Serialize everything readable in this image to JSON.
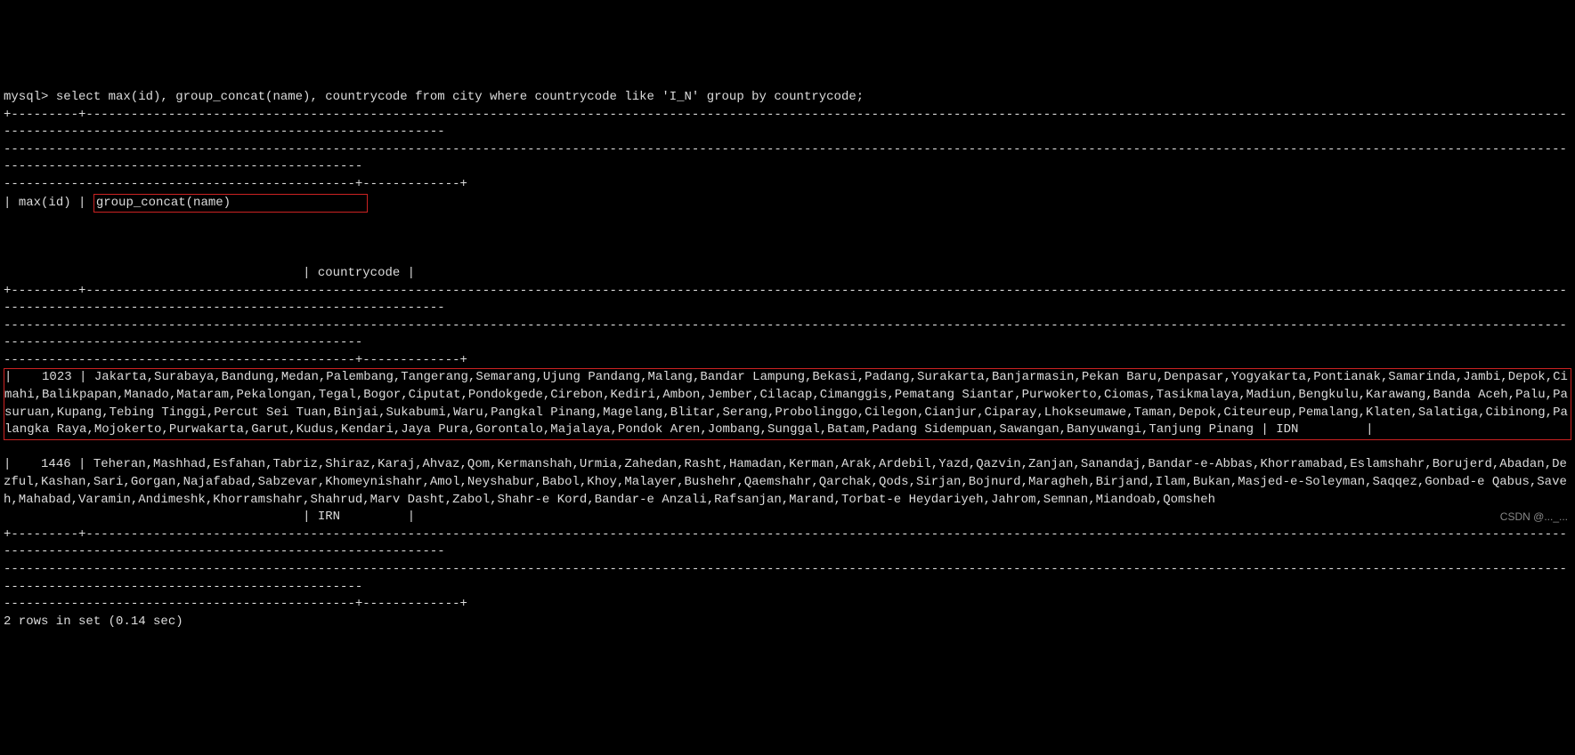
{
  "prompt": "mysql> ",
  "query": "select max(id), group_concat(name), countrycode from city where countrycode like 'I_N' group by countrycode;",
  "sep_long": "-----------------------------------------------------------------------------------------------------------------------------------------------------------------------------------------------------------------------------------------------------------------",
  "sep_short": "-----------------------------------------------",
  "header": {
    "maxid": "max(id)",
    "gconcat": "group_concat(name)",
    "cc_line": "                                        | countrycode |"
  },
  "rows": [
    {
      "id": "1023",
      "names": "Jakarta,Surabaya,Bandung,Medan,Palembang,Tangerang,Semarang,Ujung Pandang,Malang,Bandar Lampung,Bekasi,Padang,Surakarta,Banjarmasin,Pekan Baru,Denpasar,Yogyakarta,Pontianak,Samarinda,Jambi,Depok,Cimahi,Balikpapan,Manado,Mataram,Pekalongan,Tegal,Bogor,Ciputat,Pondokgede,Cirebon,Kediri,Ambon,Jember,Cilacap,Cimanggis,Pematang Siantar,Purwokerto,Ciomas,Tasikmalaya,Madiun,Bengkulu,Karawang,Banda Aceh,Palu,Pasuruan,Kupang,Tebing Tinggi,Percut Sei Tuan,Binjai,Sukabumi,Waru,Pangkal Pinang,Magelang,Blitar,Serang,Probolinggo,Cilegon,Cianjur,Ciparay,Lhokseumawe,Taman,Depok,Citeureup,Pemalang,Klaten,Salatiga,Cibinong,Palangka Raya,Mojokerto,Purwakarta,Garut,Kudus,Kendari,Jaya Pura,Gorontalo,Majalaya,Pondok Aren,Jombang,Sunggal,Batam,Padang Sidempuan,Sawangan,Banyuwangi,Tanjung Pinang",
      "cc": "IDN"
    },
    {
      "id": "1446",
      "names": "Teheran,Mashhad,Esfahan,Tabriz,Shiraz,Karaj,Ahvaz,Qom,Kermanshah,Urmia,Zahedan,Rasht,Hamadan,Kerman,Arak,Ardebil,Yazd,Qazvin,Zanjan,Sanandaj,Bandar-e-Abbas,Khorramabad,Eslamshahr,Borujerd,Abadan,Dezful,Kashan,Sari,Gorgan,Najafabad,Sabzevar,Khomeynishahr,Amol,Neyshabur,Babol,Khoy,Malayer,Bushehr,Qaemshahr,Qarchak,Qods,Sirjan,Bojnurd,Maragheh,Birjand,Ilam,Bukan,Masjed-e-Soleyman,Saqqez,Gonbad-e Qabus,Saveh,Mahabad,Varamin,Andimeshk,Khorramshahr,Shahrud,Marv Dasht,Zabol,Shahr-e Kord,Bandar-e Anzali,Rafsanjan,Marand,Torbat-e Heydariyeh,Jahrom,Semnan,Miandoab,Qomsheh",
      "cc": "IRN"
    }
  ],
  "footer": "2 rows in set (0.14 sec)",
  "watermark": "CSDN @..._..."
}
